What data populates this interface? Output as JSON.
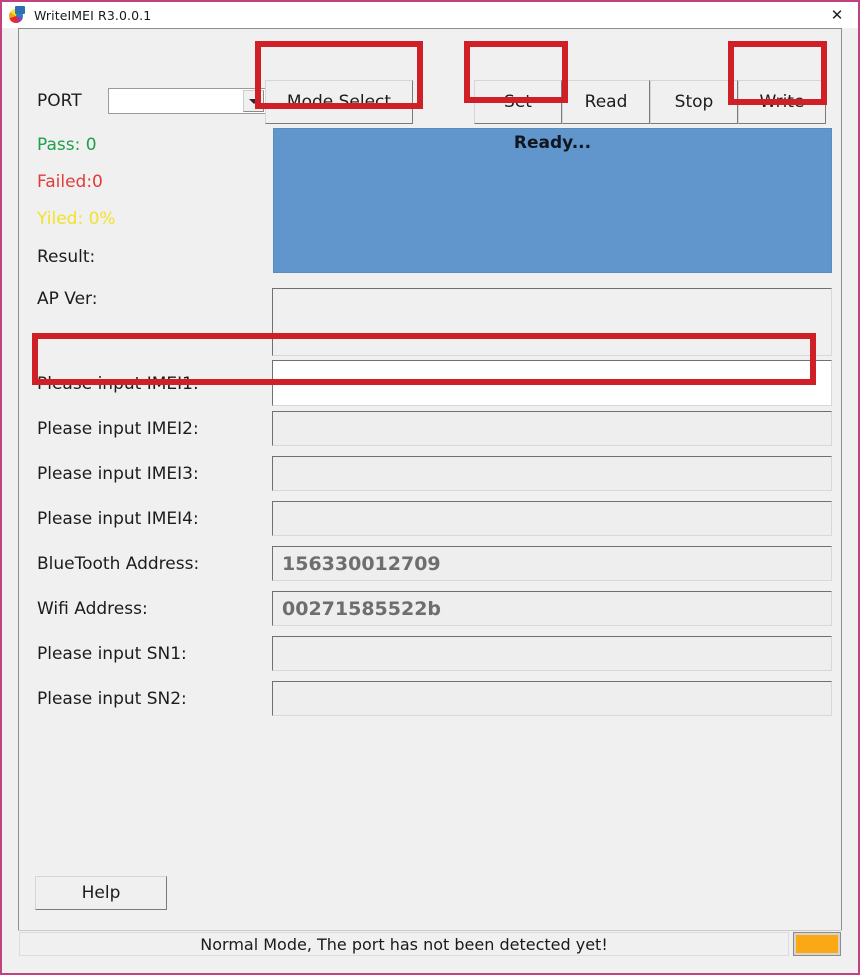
{
  "window": {
    "title": "WriteIMEI R3.0.0.1",
    "icon": "app-color-ball-icon",
    "close_label": "✕",
    "border_color": "#c2417f"
  },
  "toolbar": {
    "port_label": "PORT",
    "port_value": "",
    "port_placeholder": "",
    "dropdown_icon": "chevron-down-icon",
    "buttons": [
      {
        "label": "Mode Select",
        "highlighted": true
      },
      {
        "label": "Set",
        "highlighted": true
      },
      {
        "label": "Read",
        "highlighted": false
      },
      {
        "label": "Stop",
        "highlighted": false
      },
      {
        "label": "Write",
        "highlighted": true
      }
    ]
  },
  "counters": {
    "pass_label": "Pass:  0",
    "pass_color": "#1f9e4b",
    "failed_label": "Failed:0",
    "failed_color": "#e03c3c",
    "yield_label": "Yiled: 0%",
    "yield_color": "#f2e22a",
    "result_label": "Result:",
    "apver_label": "AP Ver:"
  },
  "log": {
    "status_text": "Ready...",
    "background_color": "#6096cb"
  },
  "fields": [
    {
      "label": "Please input IMEI1:",
      "value": "",
      "active": true,
      "highlighted": true
    },
    {
      "label": "Please input IMEI2:",
      "value": "",
      "active": false,
      "highlighted": false
    },
    {
      "label": "Please input IMEI3:",
      "value": "",
      "active": false,
      "highlighted": false
    },
    {
      "label": "Please input IMEI4:",
      "value": "",
      "active": false,
      "highlighted": false
    },
    {
      "label": "BlueTooth Address:",
      "value": "156330012709",
      "active": false,
      "highlighted": false
    },
    {
      "label": "Wifi Address:",
      "value": "00271585522b",
      "active": false,
      "highlighted": false
    },
    {
      "label": "Please input SN1:",
      "value": "",
      "active": false,
      "highlighted": false
    },
    {
      "label": "Please input SN2:",
      "value": "",
      "active": false,
      "highlighted": false
    }
  ],
  "footer": {
    "help_label": "Help",
    "status_message": "Normal Mode, The port has not been detected yet!",
    "indicator_color": "#faa816"
  }
}
